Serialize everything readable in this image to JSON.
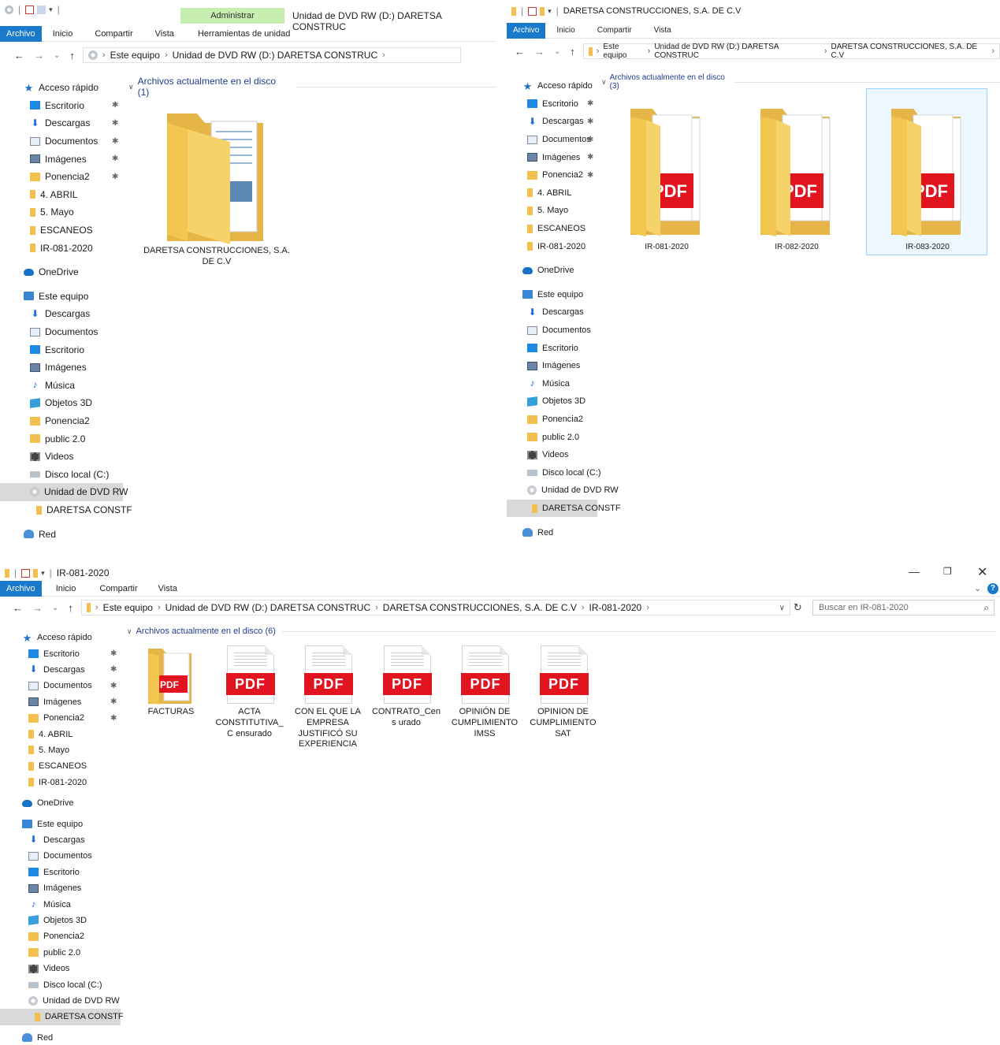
{
  "window1": {
    "context_tab": "Administrar",
    "context_subtab": "Herramientas de unidad",
    "title": "Unidad de DVD RW (D:) DARETSA CONSTRUC",
    "ribbon": [
      "Archivo",
      "Inicio",
      "Compartir",
      "Vista"
    ],
    "breadcrumb": [
      "Este equipo",
      "Unidad de DVD RW (D:) DARETSA CONSTRUC"
    ],
    "group_header": "Archivos actualmente en el disco (1)",
    "items": [
      "DARETSA CONSTRUCCIONES, S.A. DE C.V"
    ],
    "sidebar": [
      "Acceso rápido",
      "Escritorio",
      "Descargas",
      "Documentos",
      "Imágenes",
      "Ponencia2",
      "4. ABRIL",
      "5. Mayo",
      "ESCANEOS",
      "IR-081-2020",
      "OneDrive",
      "Este equipo",
      "Descargas",
      "Documentos",
      "Escritorio",
      "Imágenes",
      "Música",
      "Objetos 3D",
      "Ponencia2",
      "public 2.0",
      "Videos",
      "Disco local (C:)",
      "Unidad de DVD RW",
      "DARETSA CONSTF",
      "Red"
    ]
  },
  "window2": {
    "title": "DARETSA CONSTRUCCIONES, S.A. DE C.V",
    "ribbon": [
      "Archivo",
      "Inicio",
      "Compartir",
      "Vista"
    ],
    "breadcrumb": [
      "Este equipo",
      "Unidad de DVD RW (D:) DARETSA CONSTRUC",
      "DARETSA CONSTRUCCIONES, S.A. DE C.V"
    ],
    "group_header": "Archivos actualmente en el disco (3)",
    "items": [
      "IR-081-2020",
      "IR-082-2020",
      "IR-083-2020"
    ],
    "pdf_glyph": "PDF",
    "sidebar": [
      "Acceso rápido",
      "Escritorio",
      "Descargas",
      "Documentos",
      "Imágenes",
      "Ponencia2",
      "4. ABRIL",
      "5. Mayo",
      "ESCANEOS",
      "IR-081-2020",
      "OneDrive",
      "Este equipo",
      "Descargas",
      "Documentos",
      "Escritorio",
      "Imágenes",
      "Música",
      "Objetos 3D",
      "Ponencia2",
      "public 2.0",
      "Videos",
      "Disco local (C:)",
      "Unidad de DVD RW",
      "DARETSA CONSTF",
      "Red"
    ]
  },
  "window3": {
    "title": "IR-081-2020",
    "ribbon": [
      "Archivo",
      "Inicio",
      "Compartir",
      "Vista"
    ],
    "breadcrumb": [
      "Este equipo",
      "Unidad de DVD RW (D:) DARETSA CONSTRUC",
      "DARETSA CONSTRUCCIONES, S.A. DE C.V",
      "IR-081-2020"
    ],
    "search_placeholder": "Buscar en IR-081-2020",
    "group_header": "Archivos actualmente en el disco (6)",
    "pdf_badge": "PDF",
    "items": [
      "FACTURAS",
      "ACTA CONSTITUTIVA_C ensurado",
      "CON EL QUE LA EMPRESA JUSTIFICÓ SU EXPERIENCIA",
      "CONTRATO_Cens urado",
      "OPINIÓN DE CUMPLIMIENTO IMSS",
      "OPINION DE CUMPLIMIENTO SAT"
    ],
    "sidebar": [
      "Acceso rápido",
      "Escritorio",
      "Descargas",
      "Documentos",
      "Imágenes",
      "Ponencia2",
      "4. ABRIL",
      "5. Mayo",
      "ESCANEOS",
      "IR-081-2020",
      "OneDrive",
      "Este equipo",
      "Descargas",
      "Documentos",
      "Escritorio",
      "Imágenes",
      "Música",
      "Objetos 3D",
      "Ponencia2",
      "public 2.0",
      "Videos",
      "Disco local (C:)",
      "Unidad de DVD RW",
      "DARETSA CONSTF",
      "Red"
    ]
  }
}
